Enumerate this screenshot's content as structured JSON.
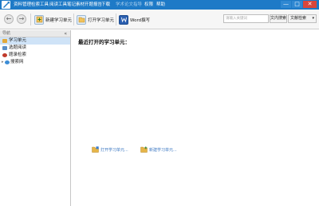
{
  "menu": {
    "items": [
      "资料管理",
      "检索工具",
      "阅读工具",
      "笔记素材",
      "开题报告",
      "下载"
    ],
    "dimmed_items": [
      "学术论文指导"
    ],
    "after_dimmed": [
      "权限",
      "帮助"
    ]
  },
  "window": {
    "min_glyph": "—",
    "max_glyph": "□",
    "close_glyph": "✕"
  },
  "toolbar": {
    "back_glyph": "←",
    "forward_glyph": "→",
    "new_unit_label": "新建学习单元",
    "open_unit_label": "打开学习单元",
    "word_label": "Word撰写",
    "search_placeholder": "请输入关键词",
    "fulltext_search_label": "文内搜索",
    "doc_search_label": "文献检索",
    "doc_search_chevron": "▾"
  },
  "sidebar": {
    "header_label": "导航",
    "collapse_glyph": "«",
    "items": [
      {
        "label": "学习单元",
        "icon": "book-icon",
        "color": "#e2a83a",
        "active": true
      },
      {
        "label": "选题阅读",
        "icon": "document-icon",
        "color": "#5a8fc8",
        "active": false
      },
      {
        "label": "题录检索",
        "icon": "search-icon",
        "color": "#c0392b",
        "active": false
      },
      {
        "label": "搜索网",
        "icon": "globe-icon",
        "color": "#3c8dd6",
        "active": false,
        "expandable": true
      }
    ],
    "expand_glyph": "▸"
  },
  "main": {
    "title": "最近打开的学习单元：",
    "links": [
      {
        "label": "打开学习单元...",
        "icon": "folder-open-icon",
        "color": "#e6b548"
      },
      {
        "label": "新建学习单元...",
        "icon": "folder-new-icon",
        "color": "#e6b548"
      }
    ]
  },
  "colors": {
    "titlebar": "#1e7ac7",
    "link": "#3c78c2",
    "selection": "#cfe3f7",
    "close_button": "#d9463b"
  }
}
